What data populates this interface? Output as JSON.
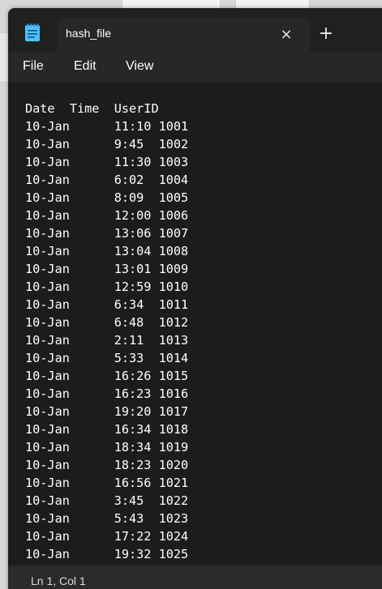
{
  "window": {
    "tab_title": "hash_file",
    "close_glyph": "×",
    "new_tab_glyph": "+"
  },
  "menu": {
    "file": "File",
    "edit": "Edit",
    "view": "View"
  },
  "editor": {
    "lines": [
      "Date  Time  UserID",
      "10-Jan      11:10 1001",
      "10-Jan      9:45  1002",
      "10-Jan      11:30 1003",
      "10-Jan      6:02  1004",
      "10-Jan      8:09  1005",
      "10-Jan      12:00 1006",
      "10-Jan      13:06 1007",
      "10-Jan      13:04 1008",
      "10-Jan      13:01 1009",
      "10-Jan      12:59 1010",
      "10-Jan      6:34  1011",
      "10-Jan      6:48  1012",
      "10-Jan      2:11  1013",
      "10-Jan      5:33  1014",
      "10-Jan      16:26 1015",
      "10-Jan      16:23 1016",
      "10-Jan      19:20 1017",
      "10-Jan      16:34 1018",
      "10-Jan      18:34 1019",
      "10-Jan      18:23 1020",
      "10-Jan      16:56 1021",
      "10-Jan      3:45  1022",
      "10-Jan      5:43  1023",
      "10-Jan      17:22 1024",
      "10-Jan      19:32 1025"
    ]
  },
  "status": {
    "position": "Ln 1, Col 1"
  },
  "icons": {
    "app": "notepad-icon",
    "close": "close-icon",
    "new_tab": "plus-icon"
  },
  "colors": {
    "titlebar": "#202020",
    "editor_bg": "#1c1c1c",
    "text": "#ffffff",
    "accent_icon": "#4cc2ff"
  }
}
